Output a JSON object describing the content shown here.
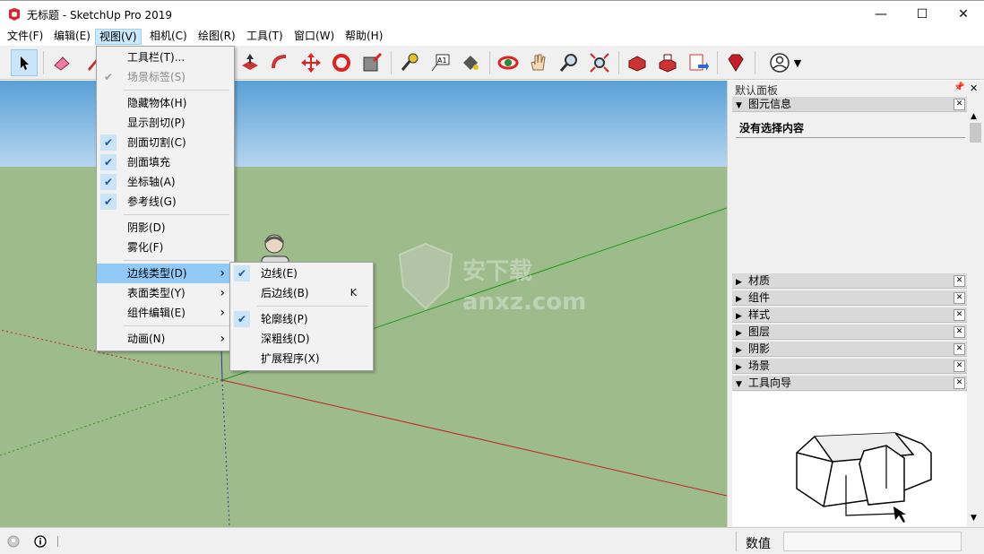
{
  "window": {
    "title": "无标题 - SketchUp Pro 2019",
    "minimize": "—",
    "maximize": "☐",
    "close": "✕"
  },
  "menubar": [
    "文件(F)",
    "编辑(E)",
    "视图(V)",
    "相机(C)",
    "绘图(R)",
    "工具(T)",
    "窗口(W)",
    "帮助(H)"
  ],
  "view_menu": {
    "items": [
      {
        "label": "工具栏(T)...",
        "checked": false,
        "enabled": true
      },
      {
        "label": "场景标签(S)",
        "checked": true,
        "enabled": false
      },
      {
        "label": "隐藏物体(H)",
        "checked": false,
        "enabled": true
      },
      {
        "label": "显示剖切(P)",
        "checked": false,
        "enabled": true
      },
      {
        "label": "剖面切割(C)",
        "checked": true,
        "enabled": true
      },
      {
        "label": "剖面填充",
        "checked": true,
        "enabled": true
      },
      {
        "label": "坐标轴(A)",
        "checked": true,
        "enabled": true
      },
      {
        "label": "参考线(G)",
        "checked": true,
        "enabled": true
      },
      {
        "label": "阴影(D)",
        "checked": false,
        "enabled": true
      },
      {
        "label": "雾化(F)",
        "checked": false,
        "enabled": true
      },
      {
        "label": "边线类型(D)",
        "checked": false,
        "enabled": true,
        "submenu": true,
        "highlighted": true
      },
      {
        "label": "表面类型(Y)",
        "checked": false,
        "enabled": true,
        "submenu": true
      },
      {
        "label": "组件编辑(E)",
        "checked": false,
        "enabled": true,
        "submenu": true
      },
      {
        "label": "动画(N)",
        "checked": false,
        "enabled": true,
        "submenu": true
      }
    ]
  },
  "edge_style_menu": {
    "items": [
      {
        "label": "边线(E)",
        "checked": true,
        "shortcut": ""
      },
      {
        "label": "后边线(B)",
        "checked": false,
        "shortcut": "K"
      },
      {
        "label": "轮廓线(P)",
        "checked": true,
        "shortcut": ""
      },
      {
        "label": "深粗线(D)",
        "checked": false,
        "shortcut": ""
      },
      {
        "label": "扩展程序(X)",
        "checked": false,
        "shortcut": ""
      }
    ]
  },
  "tray": {
    "title": "默认面板",
    "entity_info": {
      "title": "图元信息",
      "content": "没有选择内容"
    },
    "panels": [
      "材质",
      "组件",
      "样式",
      "图层",
      "阴影",
      "场景"
    ],
    "instructor": "工具向导"
  },
  "status": {
    "measure_label": "数值",
    "measure_value": ""
  },
  "watermark": "安下载 anxz.com",
  "colors": {
    "sky": "#8ec0e6",
    "ground": "#9ebc8b",
    "highlight": "#91c9f7",
    "check_bg": "#cce4f7"
  }
}
